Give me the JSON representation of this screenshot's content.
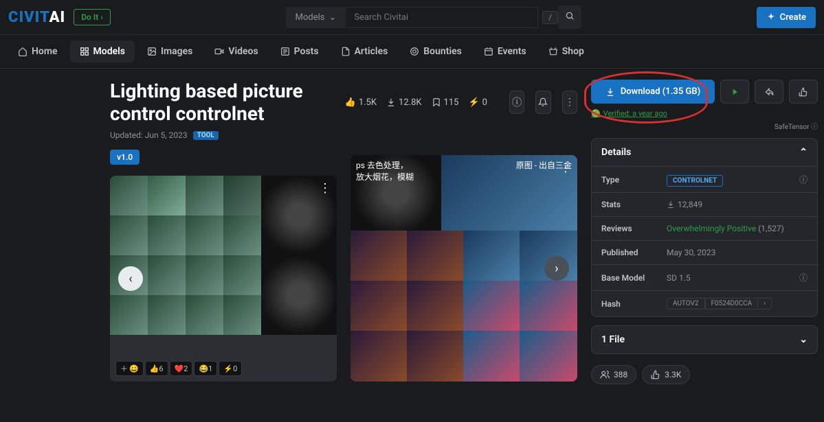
{
  "header": {
    "logo_a": "CIVIT",
    "logo_b": "AI",
    "doit": "Do It ›",
    "search_cat": "Models",
    "search_placeholder": "Search Civitai",
    "slash": "/",
    "create": "Create"
  },
  "nav": {
    "home": "Home",
    "models": "Models",
    "images": "Images",
    "videos": "Videos",
    "posts": "Posts",
    "articles": "Articles",
    "bounties": "Bounties",
    "events": "Events",
    "shop": "Shop"
  },
  "page": {
    "title": "Lighting based picture control controlnet",
    "likes": "1.5K",
    "downloads": "12.8K",
    "bookmarks": "115",
    "tips": "0",
    "updated": "Updated: Jun 5, 2023",
    "tool_tag": "TOOL",
    "version": "v1.0",
    "cn_left": "ps 去色处理，\n放大烟花，模糊",
    "cn_right": "原图 - 出自三金"
  },
  "reactions": {
    "plus": "＋",
    "smile": "😀",
    "like": "👍6",
    "heart": "❤️2",
    "laugh": "😂1",
    "zap": "⚡0"
  },
  "actions": {
    "download": "Download (1.35 GB)",
    "verified": "Verified: a year ago",
    "safetensor": "SafeTensor ⓘ"
  },
  "details": {
    "head": "Details",
    "type_l": "Type",
    "type_v": "CONTROLNET",
    "stats_l": "Stats",
    "stats_v": "12,849",
    "reviews_l": "Reviews",
    "reviews_v": "Overwhelmingly Positive",
    "reviews_n": "(1,527)",
    "pub_l": "Published",
    "pub_v": "May 30, 2023",
    "base_l": "Base Model",
    "base_v": "SD 1.5",
    "hash_l": "Hash",
    "hash_a": "AUTOV2",
    "hash_b": "F0524D0CCA",
    "hash_c": "›"
  },
  "file": {
    "head": "1 File"
  },
  "user": {
    "followers": "388",
    "likes": "3.3K"
  }
}
